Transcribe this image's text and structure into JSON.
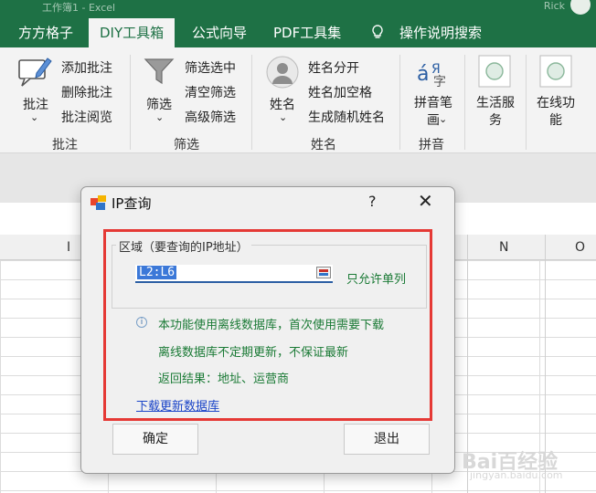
{
  "window": {
    "title": "工作簿1 - Excel",
    "user": "Rick"
  },
  "tabs": [
    {
      "label": "方方格子"
    },
    {
      "label": "DIY工具箱",
      "active": true
    },
    {
      "label": "公式向导"
    },
    {
      "label": "PDF工具集"
    },
    {
      "label": "操作说明搜索"
    }
  ],
  "ribbon": {
    "annotate": {
      "big": "批注",
      "items": [
        "添加批注",
        "删除批注",
        "批注阅览"
      ],
      "group": "批注"
    },
    "filter": {
      "big": "筛选",
      "items": [
        "筛选选中",
        "清空筛选",
        "高级筛选"
      ],
      "group": "筛选"
    },
    "name": {
      "big": "姓名",
      "items": [
        "姓名分开",
        "姓名加空格",
        "生成随机姓名"
      ],
      "group": "姓名"
    },
    "pinyin": {
      "big": "拼音笔画",
      "group": "拼音"
    },
    "life": {
      "big": "生活服务"
    },
    "online": {
      "big": "在线功能"
    }
  },
  "columns": [
    "I",
    "N",
    "O"
  ],
  "dialog": {
    "title": "IP查询",
    "help": "?",
    "close": "✕",
    "legend": "区域（要查询的IP地址）",
    "range_value": "L2:L6",
    "single_column_hint": "只允许单列",
    "notes": [
      "本功能使用离线数据库，首次使用需要下载",
      "离线数据库不定期更新，不保证最新",
      "返回结果：地址、运营商"
    ],
    "download_link": "下载更新数据库",
    "ok": "确定",
    "exit": "退出"
  },
  "watermark": {
    "main": "Bai百经验",
    "sub": "jingyan.baidu.com"
  },
  "colors": {
    "excel_green": "#1e7145",
    "highlight_red": "#e53935",
    "note_green": "#1a7a35",
    "link_blue": "#1a44c8"
  }
}
